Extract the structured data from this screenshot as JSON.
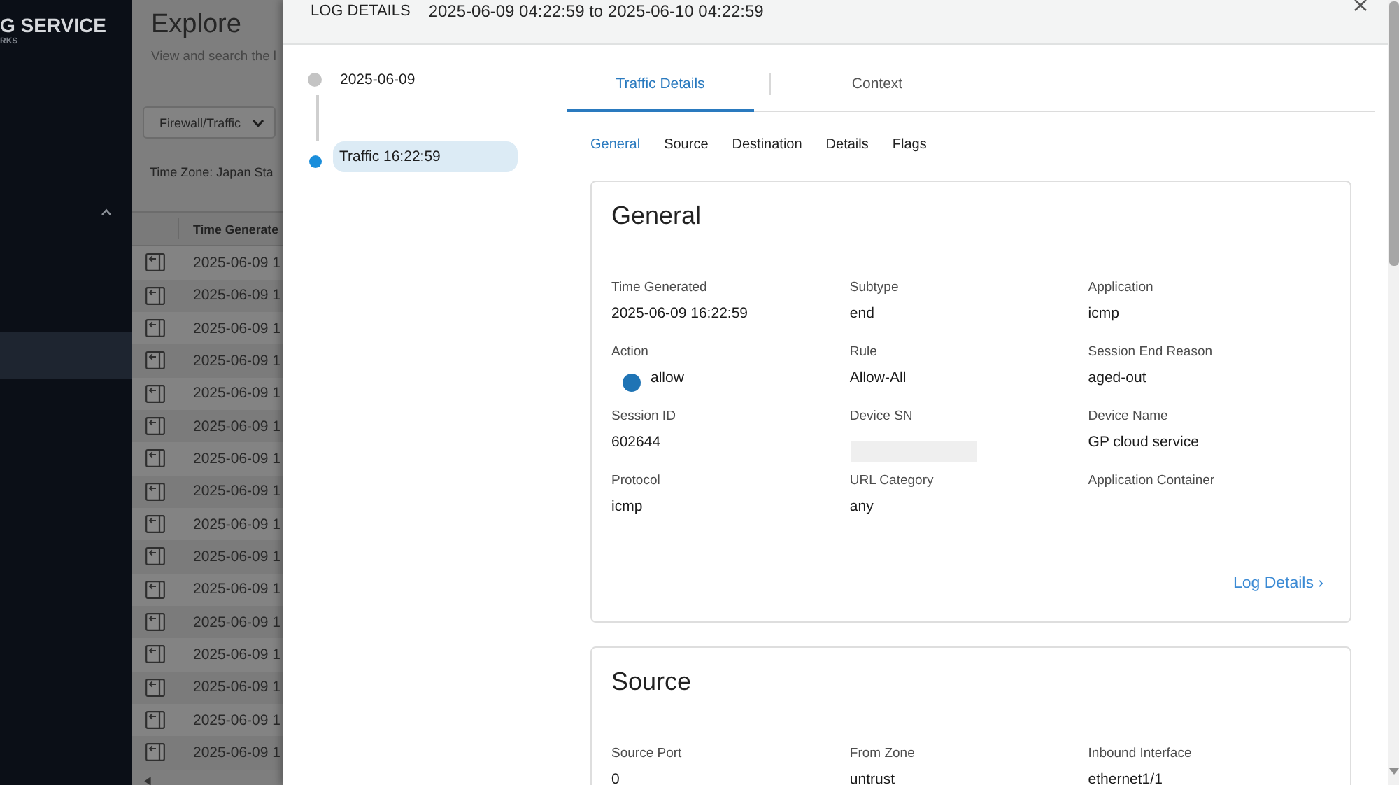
{
  "sidebar": {
    "logo": "G SERVICE",
    "logo_subtitle": "RKS"
  },
  "explore": {
    "title": "Explore",
    "subtitle": "View and search the l",
    "log_type": "Firewall/Traffic",
    "time_zone": "Time Zone: Japan Sta",
    "table": {
      "columns": [
        "Time Generate"
      ],
      "rows": [
        "2025-06-09 1",
        "2025-06-09 1",
        "2025-06-09 1",
        "2025-06-09 1",
        "2025-06-09 1",
        "2025-06-09 1",
        "2025-06-09 1",
        "2025-06-09 1",
        "2025-06-09 1",
        "2025-06-09 1",
        "2025-06-09 1",
        "2025-06-09 1",
        "2025-06-09 1",
        "2025-06-09 1",
        "2025-06-09 1",
        "2025-06-09 1"
      ]
    }
  },
  "log_details": {
    "title": "LOG DETAILS",
    "time_range": "2025-06-09 04:22:59 to 2025-06-10 04:22:59",
    "timeline": [
      {
        "kind": "date",
        "label": "2025-06-09",
        "selected": false
      },
      {
        "kind": "event",
        "label": "Traffic 16:22:59",
        "selected": true
      }
    ],
    "tabs": [
      {
        "label": "Traffic Details",
        "selected": true
      },
      {
        "label": "Context",
        "selected": false
      }
    ],
    "section_tabs": [
      {
        "label": "General",
        "selected": true
      },
      {
        "label": "Source",
        "selected": false
      },
      {
        "label": "Destination",
        "selected": false
      },
      {
        "label": "Details",
        "selected": false
      },
      {
        "label": "Flags",
        "selected": false
      }
    ],
    "sections": [
      {
        "title": "General",
        "fields": [
          {
            "label": "Time Generated",
            "kind": "text",
            "value": "2025-06-09 16:22:59"
          },
          {
            "label": "Subtype",
            "kind": "text",
            "value": "end"
          },
          {
            "label": "Application",
            "kind": "text",
            "value": "icmp"
          },
          {
            "label": "Action",
            "kind": "status",
            "value": "allow",
            "color": "#1f74b5"
          },
          {
            "label": "Rule",
            "kind": "text",
            "value": "Allow-All"
          },
          {
            "label": "Session End Reason",
            "kind": "text",
            "value": "aged-out"
          },
          {
            "label": "Session ID",
            "kind": "text",
            "value": "602644"
          },
          {
            "label": "Device SN",
            "kind": "redacted"
          },
          {
            "label": "Device Name",
            "kind": "text",
            "value": "GP cloud service"
          },
          {
            "label": "Protocol",
            "kind": "text",
            "value": "icmp"
          },
          {
            "label": "URL Category",
            "kind": "text",
            "value": "any"
          },
          {
            "label": "Application Container",
            "kind": "text"
          }
        ],
        "link": "Log Details ›"
      },
      {
        "title": "Source",
        "fields": [
          {
            "label": "Source Port",
            "kind": "text",
            "value": "0"
          },
          {
            "label": "From Zone",
            "kind": "text",
            "value": "untrust"
          },
          {
            "label": "Inbound Interface",
            "kind": "text",
            "value": "ethernet1/1"
          }
        ]
      }
    ]
  }
}
